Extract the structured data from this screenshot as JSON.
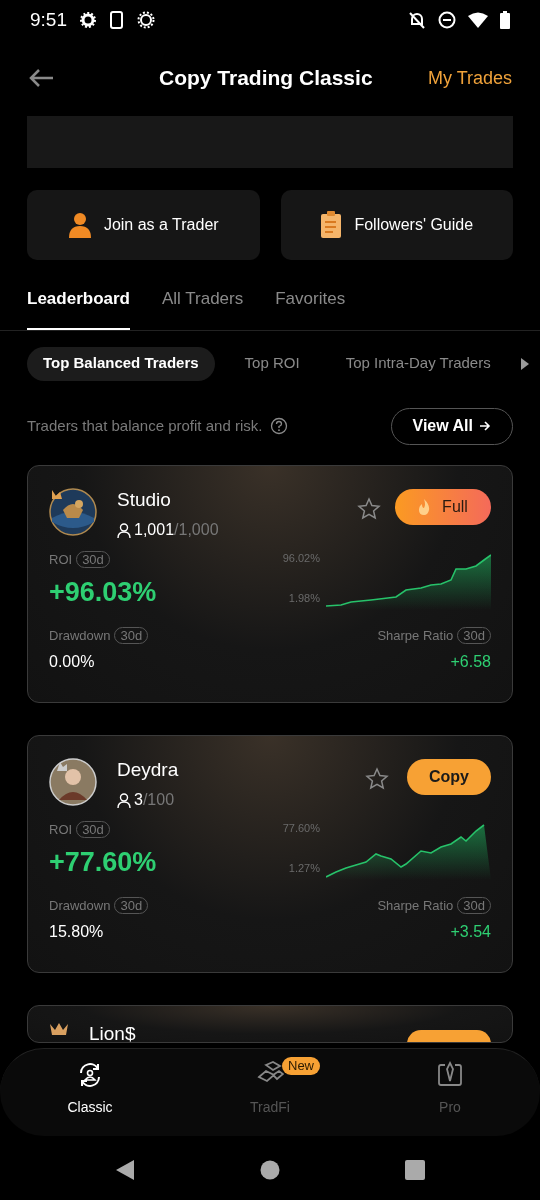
{
  "status_bar": {
    "time": "9:51"
  },
  "header": {
    "title": "Copy Trading Classic",
    "action": "My Trades"
  },
  "quick_actions": [
    {
      "kind": "person",
      "label": "Join as a Trader"
    },
    {
      "kind": "clipboard",
      "label": "Followers' Guide"
    }
  ],
  "tabs": [
    {
      "label": "Leaderboard",
      "selected": true
    },
    {
      "label": "All Traders",
      "selected": false
    },
    {
      "label": "Favorites",
      "selected": false
    }
  ],
  "chips": [
    {
      "label": "Top Balanced Traders",
      "selected": true
    },
    {
      "label": "Top ROI",
      "selected": false
    },
    {
      "label": "Top Intra-Day Traders",
      "selected": false
    }
  ],
  "section": {
    "description": "Traders that balance profit and risk.",
    "view_all": "View All"
  },
  "traders": [
    {
      "name": "Studio",
      "followers": "1,001",
      "capacity": "/1,000",
      "favorite": false,
      "button": {
        "kind": "full",
        "label": "Full"
      },
      "roi_label": "ROI",
      "roi_period": "30d",
      "roi": "+96.03%",
      "chart_high": "96.02%",
      "chart_low": "1.98%",
      "drawdown_label": "Drawdown",
      "drawdown_period": "30d",
      "drawdown": "0.00%",
      "sharpe_label": "Sharpe Ratio",
      "sharpe_period": "30d",
      "sharpe": "+6.58"
    },
    {
      "name": "Deydra",
      "followers": "3",
      "capacity": "/100",
      "favorite": false,
      "button": {
        "kind": "copy",
        "label": "Copy"
      },
      "roi_label": "ROI",
      "roi_period": "30d",
      "roi": "+77.60%",
      "chart_high": "77.60%",
      "chart_low": "1.27%",
      "drawdown_label": "Drawdown",
      "drawdown_period": "30d",
      "drawdown": "15.80%",
      "sharpe_label": "Sharpe Ratio",
      "sharpe_period": "30d",
      "sharpe": "+3.54"
    },
    {
      "name": "Lion$"
    }
  ],
  "bottom_nav": [
    {
      "label": "Classic",
      "selected": true
    },
    {
      "label": "TradFi",
      "selected": false,
      "badge": "New"
    },
    {
      "label": "Pro",
      "selected": false
    }
  ]
}
